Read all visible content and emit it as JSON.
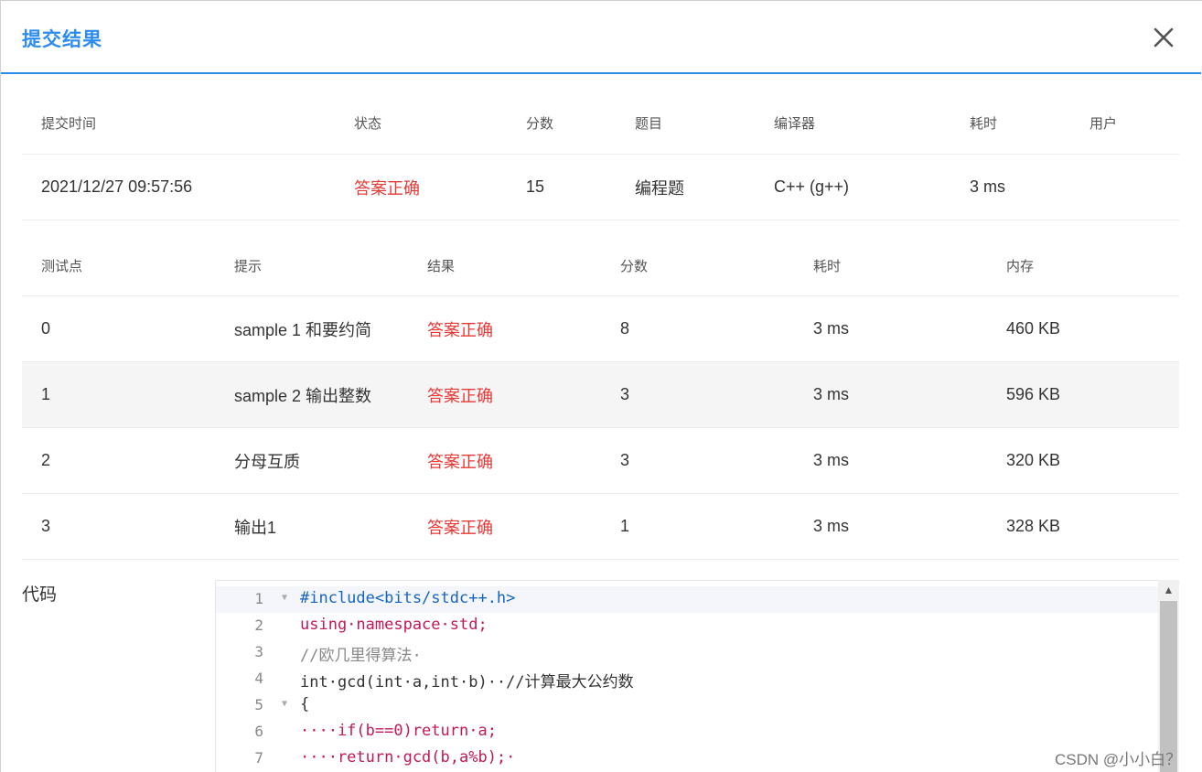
{
  "dialog": {
    "title": "提交结果",
    "close_icon": "close-icon"
  },
  "summary": {
    "headers": [
      "提交时间",
      "状态",
      "分数",
      "题目",
      "编译器",
      "耗时",
      "用户"
    ],
    "row": [
      "2021/12/27 09:57:56",
      "答案正确",
      "15",
      "编程题",
      "C++ (g++)",
      "3 ms",
      ""
    ]
  },
  "cases": {
    "headers": [
      "测试点",
      "提示",
      "结果",
      "分数",
      "耗时",
      "内存"
    ],
    "rows": [
      [
        "0",
        "sample 1 和要约简",
        "答案正确",
        "8",
        "3 ms",
        "460 KB"
      ],
      [
        "1",
        "sample 2 输出整数",
        "答案正确",
        "3",
        "3 ms",
        "596 KB"
      ],
      [
        "2",
        "分母互质",
        "答案正确",
        "3",
        "3 ms",
        "320 KB"
      ],
      [
        "3",
        "输出1",
        "答案正确",
        "1",
        "3 ms",
        "328 KB"
      ]
    ]
  },
  "code": {
    "label": "代码",
    "line_numbers": [
      "1",
      "2",
      "3",
      "4",
      "5",
      "6",
      "7"
    ],
    "lines": [
      "#include<bits/stdc++.h>",
      "using·namespace·std;",
      "//欧几里得算法·",
      "int·gcd(int·a,int·b)··//计算最大公约数",
      "{",
      "····if(b==0)return·a;",
      "····return·gcd(b,a%b);·"
    ]
  },
  "colors": {
    "accent": "#2d8cf0",
    "accepted": "#e53935"
  },
  "watermark": "CSDN @小小白？"
}
